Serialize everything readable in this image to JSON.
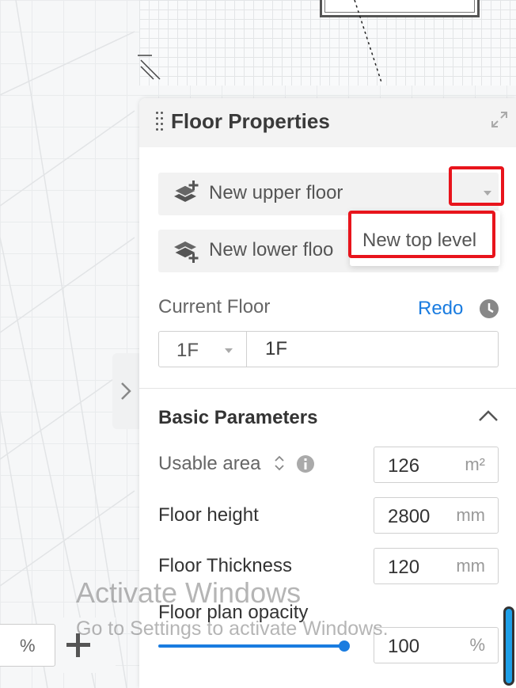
{
  "panel": {
    "title": "Floor Properties",
    "new_upper_floor_label": "New upper floor",
    "new_lower_floor_label": "New lower floo",
    "dropdown_option": "New top level",
    "current_floor_label": "Current Floor",
    "redo_label": "Redo",
    "floor_select_value": "1F",
    "floor_name_value": "1F"
  },
  "basic_parameters": {
    "title": "Basic Parameters",
    "usable_area": {
      "label": "Usable area",
      "value": "126",
      "unit": "m²"
    },
    "floor_height": {
      "label": "Floor height",
      "value": "2800",
      "unit": "mm"
    },
    "floor_thickness": {
      "label": "Floor Thickness",
      "value": "120",
      "unit": "mm"
    },
    "floor_plan_opacity": {
      "label": "Floor plan opacity",
      "value": "100",
      "unit": "%",
      "level": 100
    }
  },
  "zoom": {
    "unit": "%"
  },
  "watermark": {
    "title": "Activate Windows",
    "subtitle": "Go to Settings to activate Windows."
  },
  "colors": {
    "accent": "#1a7ce0",
    "highlight": "#e8141c"
  },
  "icons": [
    "drag-handle-icon",
    "expand-icon",
    "layer-add-up-icon",
    "layer-add-down-icon",
    "chevron-down-icon",
    "history-clock-icon",
    "chevron-up-icon",
    "sort-icon",
    "info-icon",
    "chevron-right-icon",
    "plus-icon"
  ]
}
